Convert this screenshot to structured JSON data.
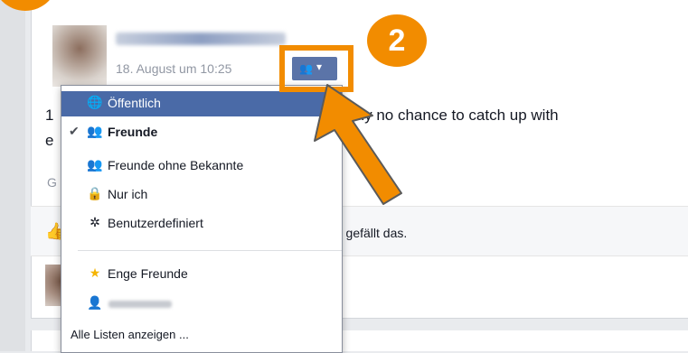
{
  "colors": {
    "accent": "#f28c00",
    "menu_selected": "#4a6aa7",
    "fb_blue": "#5b74a8"
  },
  "post": {
    "timestamp": "18. August um 10:25",
    "text_line1": "1",
    "text_line1_end": "erally no chance to catch up with",
    "text_line2": "e",
    "ghost_text": "G",
    "like_text": "r gefällt das.",
    "privacy_button_icon": "friends-icon",
    "privacy_button_caret": "caret-down-icon"
  },
  "annotation": {
    "step2": "2"
  },
  "privacy_menu": {
    "items": [
      {
        "label": "Öffentlich",
        "icon": "globe-icon",
        "selected_highlight": true
      },
      {
        "label": "Freunde",
        "icon": "friends-icon",
        "checked": true
      },
      {
        "label": "Freunde ohne Bekannte",
        "icon": "friends-except-icon"
      },
      {
        "label": "Nur ich",
        "icon": "lock-icon"
      },
      {
        "label": "Benutzerdefiniert",
        "icon": "gear-icon"
      }
    ],
    "lists": [
      {
        "label": "Enge Freunde",
        "icon": "star-icon"
      },
      {
        "label": "",
        "icon": "list-icon"
      }
    ],
    "show_all": "Alle Listen anzeigen ..."
  }
}
